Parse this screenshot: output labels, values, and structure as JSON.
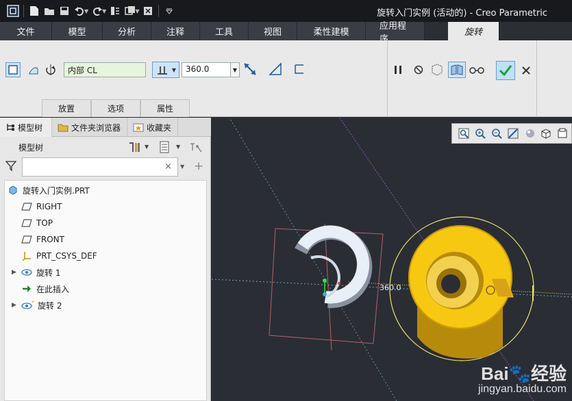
{
  "window": {
    "title": "旋转入门实例 (活动的) - Creo Parametric"
  },
  "ribbon_tabs": [
    "文件",
    "模型",
    "分析",
    "注释",
    "工具",
    "视图",
    "柔性建模",
    "应用程序"
  ],
  "active_tab": "旋转",
  "revolve": {
    "axis_value": "内部 CL",
    "angle_value": "360.0",
    "sub_tabs": [
      "放置",
      "选项",
      "属性"
    ]
  },
  "nav_tabs": [
    "模型树",
    "文件夹浏览器",
    "收藏夹"
  ],
  "model_tree": {
    "title": "模型树",
    "filter_placeholder": "",
    "items": [
      {
        "label": "旋转入门实例.PRT",
        "icon": "part-icon"
      },
      {
        "label": "RIGHT",
        "icon": "datum-plane-icon"
      },
      {
        "label": "TOP",
        "icon": "datum-plane-icon"
      },
      {
        "label": "FRONT",
        "icon": "datum-plane-icon"
      },
      {
        "label": "PRT_CSYS_DEF",
        "icon": "csys-icon"
      },
      {
        "label": "旋转 1",
        "icon": "revolve-icon"
      },
      {
        "label": "在此插入",
        "icon": "insert-here-icon"
      },
      {
        "label": "旋转 2",
        "icon": "revolve-active-icon"
      }
    ]
  },
  "viewport": {
    "dimension_label": "360.0"
  },
  "watermark": {
    "brand": "Bai",
    "brand2": "经验",
    "url": "jingyan.baidu.com"
  }
}
